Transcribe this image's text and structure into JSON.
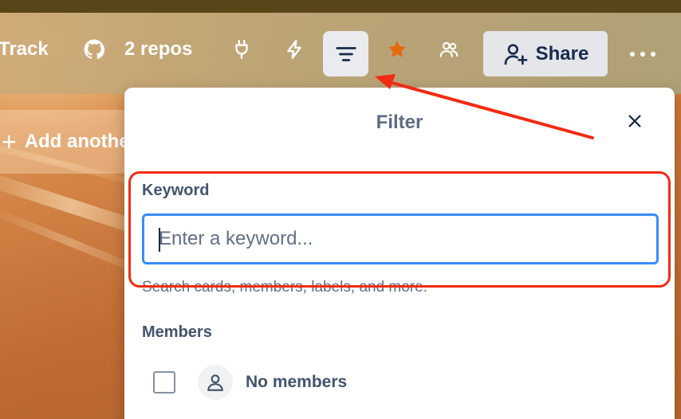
{
  "header": {
    "board_name_partial": "Track",
    "repos_label": "2 repos",
    "share_label": "Share"
  },
  "icons": {
    "github": "github-icon",
    "plug": "power-ups-icon",
    "bolt": "automation-icon",
    "filter": "filter-icon",
    "star": "star-icon",
    "members": "members-icon",
    "share": "add-user-icon",
    "more": "more-icon",
    "close": "close-icon"
  },
  "board": {
    "add_list_label": "Add another list"
  },
  "filter_popover": {
    "title": "Filter",
    "keyword": {
      "label": "Keyword",
      "value": "",
      "placeholder": "Enter a keyword...",
      "helper": "Search cards, members, labels, and more."
    },
    "members": {
      "label": "Members",
      "items": [
        {
          "label": "No members",
          "checked": false
        }
      ]
    }
  },
  "colors": {
    "star": "#e56910",
    "annotation": "#f22b14",
    "input_focus": "#388bff"
  }
}
